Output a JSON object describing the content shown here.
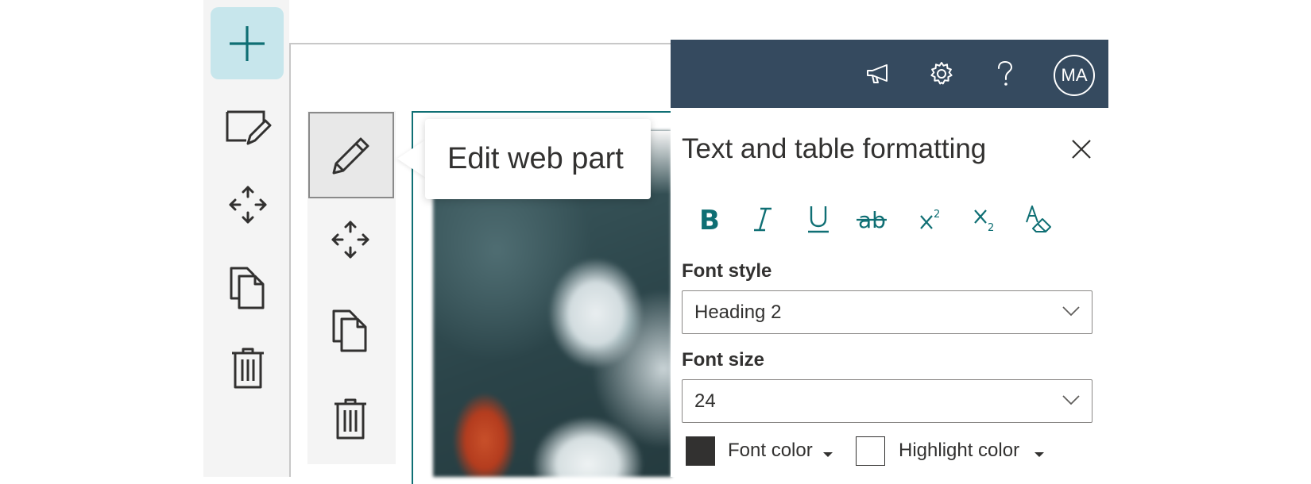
{
  "tooltip": {
    "text": "Edit web part"
  },
  "suite": {
    "avatar_initials": "MA"
  },
  "pane": {
    "title": "Text and table formatting",
    "font_style": {
      "label": "Font style",
      "value": "Heading 2"
    },
    "font_size": {
      "label": "Font size",
      "value": "24"
    },
    "font_color": {
      "label": "Font color",
      "swatch": "#323130"
    },
    "highlight_color": {
      "label": "Highlight color",
      "swatch": "#ffffff"
    }
  },
  "colors": {
    "accent": "#0f6f74",
    "suite_bar": "#354a5f",
    "add_button_bg": "#c7e6ec"
  }
}
